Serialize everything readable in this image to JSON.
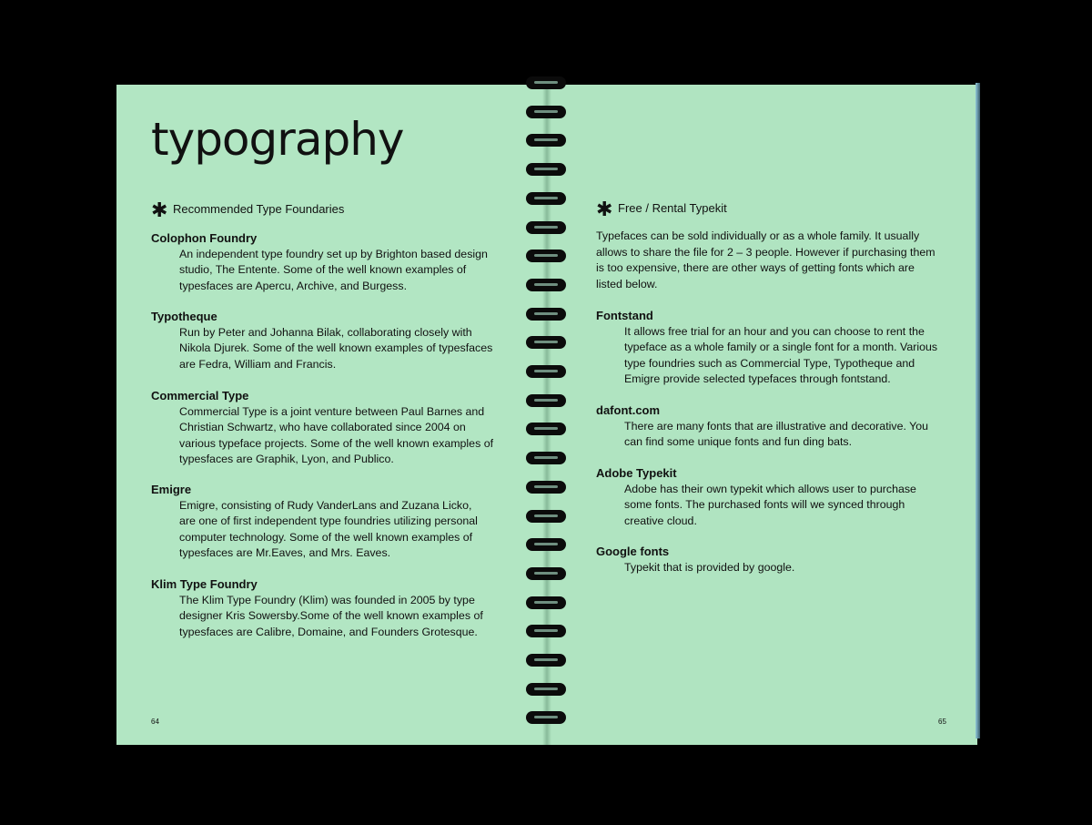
{
  "left_page": {
    "title": "typography",
    "section_heading": "Recommended Type Foundaries",
    "page_number": "64",
    "entries": [
      {
        "name": "Colophon Foundry",
        "lines": [
          "An independent type foundry set up by Brighton based design",
          "studio, The Entente. Some of the well known examples of",
          "typesfaces are Apercu, Archive, and Burgess."
        ]
      },
      {
        "name": "Typotheque",
        "lines": [
          "Run by Peter and Johanna Bilak, collaborating closely with",
          "Nikola Djurek. Some of the well known examples of typesfaces",
          "are Fedra, William and Francis."
        ]
      },
      {
        "name": "Commercial Type",
        "lines": [
          "Commercial Type is a joint venture between Paul Barnes and",
          "Christian Schwartz, who have collaborated since 2004 on",
          "various typeface projects. Some of the well known examples of",
          "typesfaces are Graphik, Lyon, and Publico."
        ]
      },
      {
        "name": "Emigre",
        "lines": [
          "Emigre, consisting of Rudy VanderLans and Zuzana Licko,",
          "are one of first independent type foundries utilizing personal",
          "computer technology. Some of the well known examples of",
          "typesfaces are Mr.Eaves, and Mrs. Eaves."
        ]
      },
      {
        "name": "Klim Type Foundry",
        "lines": [
          "The Klim Type Foundry (Klim) was founded in 2005 by type",
          "designer Kris Sowersby.Some of the well known examples of",
          "typesfaces are Calibre, Domaine, and Founders Grotesque."
        ]
      }
    ]
  },
  "right_page": {
    "section_heading": "Free / Rental Typekit",
    "page_number": "65",
    "intro_lines": [
      "Typefaces can be sold individually or as a whole family. It usually",
      "allows to share the file for 2 – 3 people. However if purchasing them",
      "is too expensive, there are other ways of getting fonts which are",
      "listed below."
    ],
    "entries": [
      {
        "name": "Fontstand",
        "lines": [
          "It allows free trial for an hour and you can choose to rent the",
          "typeface as a whole family or a single font for a month. Various",
          "type foundries such as Commercial Type, Typotheque and",
          "Emigre provide selected typefaces through fontstand."
        ]
      },
      {
        "name": "dafont.com",
        "lines": [
          "There are many fonts that are illustrative and decorative. You",
          "can find some unique fonts and fun ding bats."
        ]
      },
      {
        "name": "Adobe Typekit",
        "lines": [
          "Adobe has their own typekit which allows user to purchase",
          "some fonts. The purchased fonts will we synced through",
          "creative cloud."
        ]
      },
      {
        "name": "Google fonts",
        "lines": [
          "Typekit that is provided by google."
        ]
      }
    ]
  },
  "icons": {
    "section_marker": "asterisk-icon"
  },
  "colors": {
    "paper": "#b2e6c3",
    "background": "#000000",
    "ink": "#111111"
  }
}
